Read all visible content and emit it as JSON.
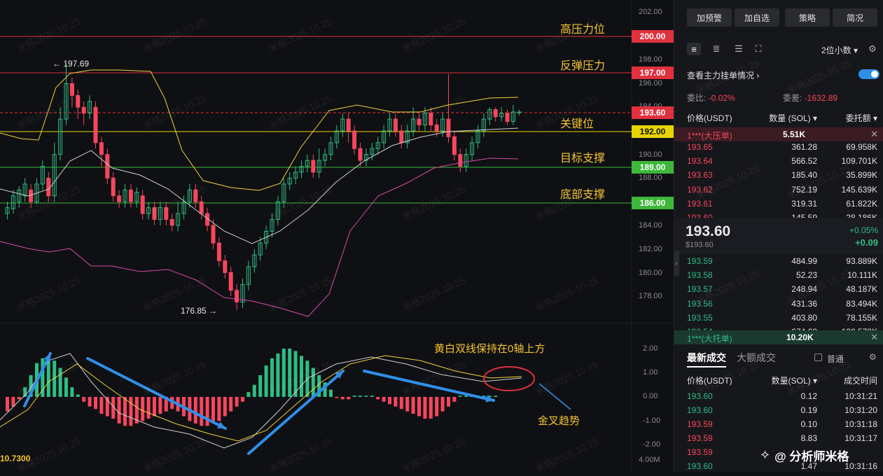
{
  "chart": {
    "price_axis": [
      "202.00",
      "200.00",
      "198.00",
      "196.00",
      "194.00",
      "190.00",
      "188.00",
      "184.00",
      "182.00",
      "180.00",
      "178.00"
    ],
    "macd_axis": [
      "2.00",
      "1.00",
      "0.00",
      "-1.00",
      "-2.00"
    ],
    "volume_label": "4.00M",
    "bottom_left_value": "10.7300",
    "high_label": "← 197.69",
    "low_label": "176.85 →",
    "levels": [
      {
        "price": "200.00",
        "label": "高压力位",
        "color": "#e0313e"
      },
      {
        "price": "197.00",
        "label": "反弹压力",
        "color": "#e0313e"
      },
      {
        "price": "193.60",
        "label": "关键位",
        "color": "#e0313e"
      },
      {
        "price": "192.00",
        "label": "",
        "color": "#e8d400"
      },
      {
        "price": "189.00",
        "label": "目标支撑",
        "color": "#3db83a"
      },
      {
        "price": "186.00",
        "label": "底部支撑",
        "color": "#3db83a"
      }
    ],
    "macd_note": "黄白双线保持在0轴上方",
    "golden_cross_note": "金叉趋势",
    "watermark": "米格2025.10.25",
    "logo_text": "@ 分析师米格",
    "colors": {
      "up": "#2ebd85",
      "down": "#f6465d",
      "ma_white": "#cfcfcf",
      "ma_yellow": "#f0d23c",
      "band_pink": "#d84aa8",
      "arrow": "#2f8fe8"
    }
  },
  "panel": {
    "buttons": [
      "加预警",
      "加自选",
      "策略",
      "简况"
    ],
    "decimals": "2位小数",
    "view_main_orders": "查看主力挂单情况",
    "weibi_label": "委比:",
    "weibi_value": "-0.02%",
    "weicha_label": "委差:",
    "weicha_value": "-1632.89",
    "headers": {
      "price": "价格(USDT)",
      "qty": "数量 (SOL)",
      "total": "委托额"
    },
    "big_ask": {
      "label": "1***(大压单)",
      "value": "5.51K"
    },
    "asks": [
      {
        "p": "193.65",
        "q": "361.28",
        "t": "69.958K"
      },
      {
        "p": "193.64",
        "q": "566.52",
        "t": "109.701K"
      },
      {
        "p": "193.63",
        "q": "185.40",
        "t": "35.899K"
      },
      {
        "p": "193.62",
        "q": "752.19",
        "t": "145.639K"
      },
      {
        "p": "193.61",
        "q": "319.31",
        "t": "61.822K"
      },
      {
        "p": "193.60",
        "q": "145.59",
        "t": "28.186K"
      }
    ],
    "last_price": "193.60",
    "last_price_usd": "$193.60",
    "change_pct": "+0.05%",
    "change_abs": "+0.09",
    "bids": [
      {
        "p": "193.59",
        "q": "484.99",
        "t": "93.889K"
      },
      {
        "p": "193.58",
        "q": "52.23",
        "t": "10.111K"
      },
      {
        "p": "193.57",
        "q": "248.94",
        "t": "48.187K"
      },
      {
        "p": "193.56",
        "q": "431.36",
        "t": "83.494K"
      },
      {
        "p": "193.55",
        "q": "403.80",
        "t": "78.155K"
      },
      {
        "p": "193.54",
        "q": "674.68",
        "t": "130.570K"
      }
    ],
    "big_bid": {
      "label": "1***(大托单)",
      "value": "10.20K"
    },
    "trades_tab": "最新成交",
    "big_trades_tab": "大额成交",
    "normal_label": "普通",
    "trade_headers": {
      "price": "价格(USDT)",
      "qty": "数量(SOL)",
      "time": "成交时间"
    },
    "trades": [
      {
        "p": "193.60",
        "q": "0.12",
        "t": "10:31:21",
        "side": "buy"
      },
      {
        "p": "193.60",
        "q": "0.19",
        "t": "10:31:20",
        "side": "buy"
      },
      {
        "p": "193.59",
        "q": "0.10",
        "t": "10:31:18",
        "side": "sell"
      },
      {
        "p": "193.59",
        "q": "8.83",
        "t": "10:31:17",
        "side": "sell"
      },
      {
        "p": "193.59",
        "q": "",
        "t": "",
        "side": "sell"
      },
      {
        "p": "193.60",
        "q": "1.47",
        "t": "10:31:16",
        "side": "buy"
      }
    ]
  }
}
